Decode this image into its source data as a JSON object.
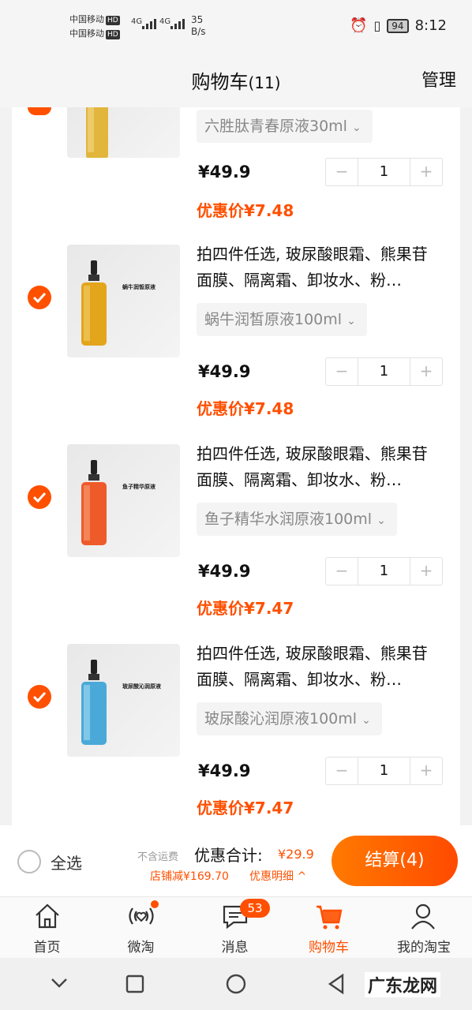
{
  "status_bar": {
    "carrier_1": "中国移动",
    "carrier_2": "中国移动",
    "hd_label": "HD",
    "network_1": "4G",
    "network_2": "4G",
    "speed_value": "35",
    "speed_unit": "B/s",
    "battery": "94",
    "time": "8:12"
  },
  "header": {
    "title": "购物车",
    "count": "(11)",
    "manage_label": "管理"
  },
  "cart_items": [
    {
      "variant": "六胜肽青春原液30ml",
      "price": "¥49.9",
      "quantity": "1",
      "promo_label": "优惠价",
      "promo_price": "¥7.48",
      "accent": "#e2b53c"
    },
    {
      "description": "拍四件任选, 玻尿酸眼霜、熊果苷面膜、隔离霜、卸妆水、粉…",
      "variant": "蜗牛润皙原液100ml",
      "price": "¥49.9",
      "quantity": "1",
      "promo_label": "优惠价",
      "promo_price": "¥7.48",
      "label_title": "蜗牛润皙原液",
      "accent": "#e2a51c",
      "selected": true
    },
    {
      "description": "拍四件任选, 玻尿酸眼霜、熊果苷面膜、隔离霜、卸妆水、粉…",
      "variant": "鱼子精华水润原液100ml",
      "price": "¥49.9",
      "quantity": "1",
      "promo_label": "优惠价",
      "promo_price": "¥7.47",
      "label_title": "鱼子精华原液",
      "accent": "#ef5a2a",
      "selected": true
    },
    {
      "description": "拍四件任选, 玻尿酸眼霜、熊果苷面膜、隔离霜、卸妆水、粉…",
      "variant": "玻尿酸沁润原液100ml",
      "price": "¥49.9",
      "quantity": "1",
      "promo_label": "优惠价",
      "promo_price": "¥7.47",
      "label_title": "玻尿酸沁润原液",
      "accent": "#4aa9d8",
      "selected": true
    }
  ],
  "qty_minus": "−",
  "qty_plus": "+",
  "footer": {
    "select_all": "全选",
    "no_shipping": "不含运费",
    "total_label": "优惠合计:",
    "total_value": "¥29.9",
    "shop_discount": "店铺减¥169.70",
    "discount_detail": "优惠明细",
    "checkout_label": "结算(4)"
  },
  "tabbar": {
    "home": "首页",
    "weitao": "微淘",
    "messages": "消息",
    "messages_badge": "53",
    "cart": "购物车",
    "my_taobao": "我的淘宝"
  },
  "watermark": "广东龙网",
  "colors": {
    "accent": "#ff5000"
  }
}
